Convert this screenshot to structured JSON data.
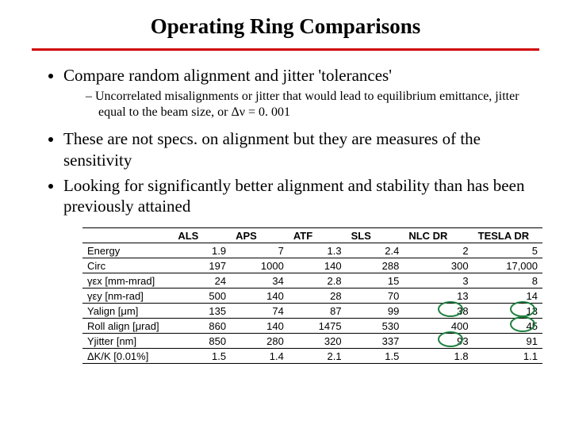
{
  "title": "Operating Ring Comparisons",
  "bullets": {
    "b0": "Compare random alignment and jitter 'tolerances'",
    "sub0": "Uncorrelated misalignments or jitter that would lead to equilibrium emittance, jitter equal to the beam size, or Δν = 0. 001",
    "b1": "These are not specs. on alignment but they are measures of the sensitivity",
    "b2": "Looking for significantly better alignment and stability than has been previously attained"
  },
  "table": {
    "headers": [
      "",
      "ALS",
      "APS",
      "ATF",
      "SLS",
      "NLC DR",
      "TESLA DR"
    ],
    "rows": [
      {
        "label": "Energy",
        "vals": [
          "1.9",
          "7",
          "1.3",
          "2.4",
          "2",
          "5"
        ]
      },
      {
        "label": "Circ",
        "vals": [
          "197",
          "1000",
          "140",
          "288",
          "300",
          "17,000"
        ]
      },
      {
        "label": "γεx [mm-mrad]",
        "vals": [
          "24",
          "34",
          "2.8",
          "15",
          "3",
          "8"
        ]
      },
      {
        "label": "γεy [nm-rad]",
        "vals": [
          "500",
          "140",
          "28",
          "70",
          "13",
          "14"
        ]
      },
      {
        "label": "Yalign [μm]",
        "vals": [
          "135",
          "74",
          "87",
          "99",
          "38",
          "13"
        ]
      },
      {
        "label": "Roll align [μrad]",
        "vals": [
          "860",
          "140",
          "1475",
          "530",
          "400",
          "45"
        ]
      },
      {
        "label": "Yjitter [nm]",
        "vals": [
          "850",
          "280",
          "320",
          "337",
          "93",
          "91"
        ]
      },
      {
        "label": "ΔK/K [0.01%]",
        "vals": [
          "1.5",
          "1.4",
          "2.1",
          "1.5",
          "1.8",
          "1.1"
        ]
      }
    ]
  }
}
